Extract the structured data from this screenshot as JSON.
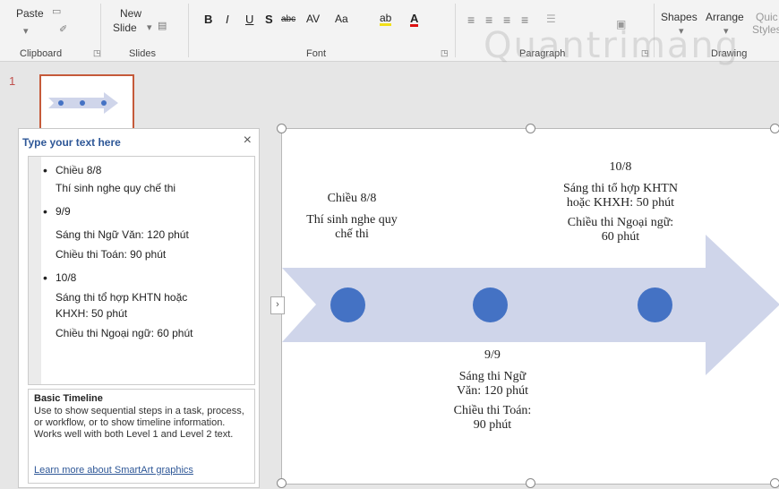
{
  "ribbon": {
    "clipboard": {
      "paste": "Paste",
      "label": "Clipboard"
    },
    "slides": {
      "new_slide_line1": "New",
      "new_slide_line2": "Slide",
      "label": "Slides"
    },
    "font": {
      "bold": "B",
      "italic": "I",
      "underline": "U",
      "shadow": "S",
      "strike": "abc",
      "spacing": "AV",
      "case": "Aa",
      "label": "Font"
    },
    "paragraph": {
      "label": "Paragraph"
    },
    "drawing": {
      "shapes": "Shapes",
      "arrange": "Arrange",
      "quick": "Quic",
      "styles": "Styles",
      "label": "Drawing"
    }
  },
  "thumbnails": {
    "slide_number": "1"
  },
  "text_pane": {
    "title": "Type your text here",
    "close": "×",
    "items": [
      {
        "text": "Chiều 8/8",
        "level": 1
      },
      {
        "text": "Thí sinh nghe quy chế thi",
        "level": 2
      },
      {
        "text": "9/9",
        "level": 1
      },
      {
        "text": "Sáng thi Ngữ Văn: 120 phút",
        "level": 2
      },
      {
        "text": "Chiều thi Toán: 90 phút",
        "level": 2
      },
      {
        "text": "10/8",
        "level": 1
      },
      {
        "text": "Sáng thi tổ hợp KHTN hoặc",
        "level": 2
      },
      {
        "text": "KHXH: 50 phút",
        "level": 2
      },
      {
        "text": "Chiều thi Ngoại ngữ: 60 phút",
        "level": 2
      }
    ],
    "desc_title": "Basic Timeline",
    "desc_body": "Use to show sequential steps in a task, process, or workflow, or to show timeline information. Works well with both Level 1 and Level 2 text.",
    "desc_link": "Learn more about SmartArt graphics"
  },
  "slide": {
    "expand": "›",
    "top_left": {
      "l1": "Chiều 8/8",
      "l2a": "Thí sinh nghe quy",
      "l2b": "chế thi"
    },
    "top_right": {
      "l1": "10/8",
      "l2a": "Sáng thi tổ hợp KHTN",
      "l2b": "hoặc KHXH: 50 phút",
      "l3a": "Chiều thi Ngoại ngữ:",
      "l3b": "60 phút"
    },
    "bottom_mid": {
      "l1": "9/9",
      "l2a": "Sáng thi Ngữ",
      "l2b": "Văn: 120 phút",
      "l3a": "Chiều thi Toán:",
      "l3b": "90 phút"
    },
    "arrow_color": "#cfd5ea",
    "node_color": "#4472c4"
  },
  "watermark": "Quantrimang"
}
